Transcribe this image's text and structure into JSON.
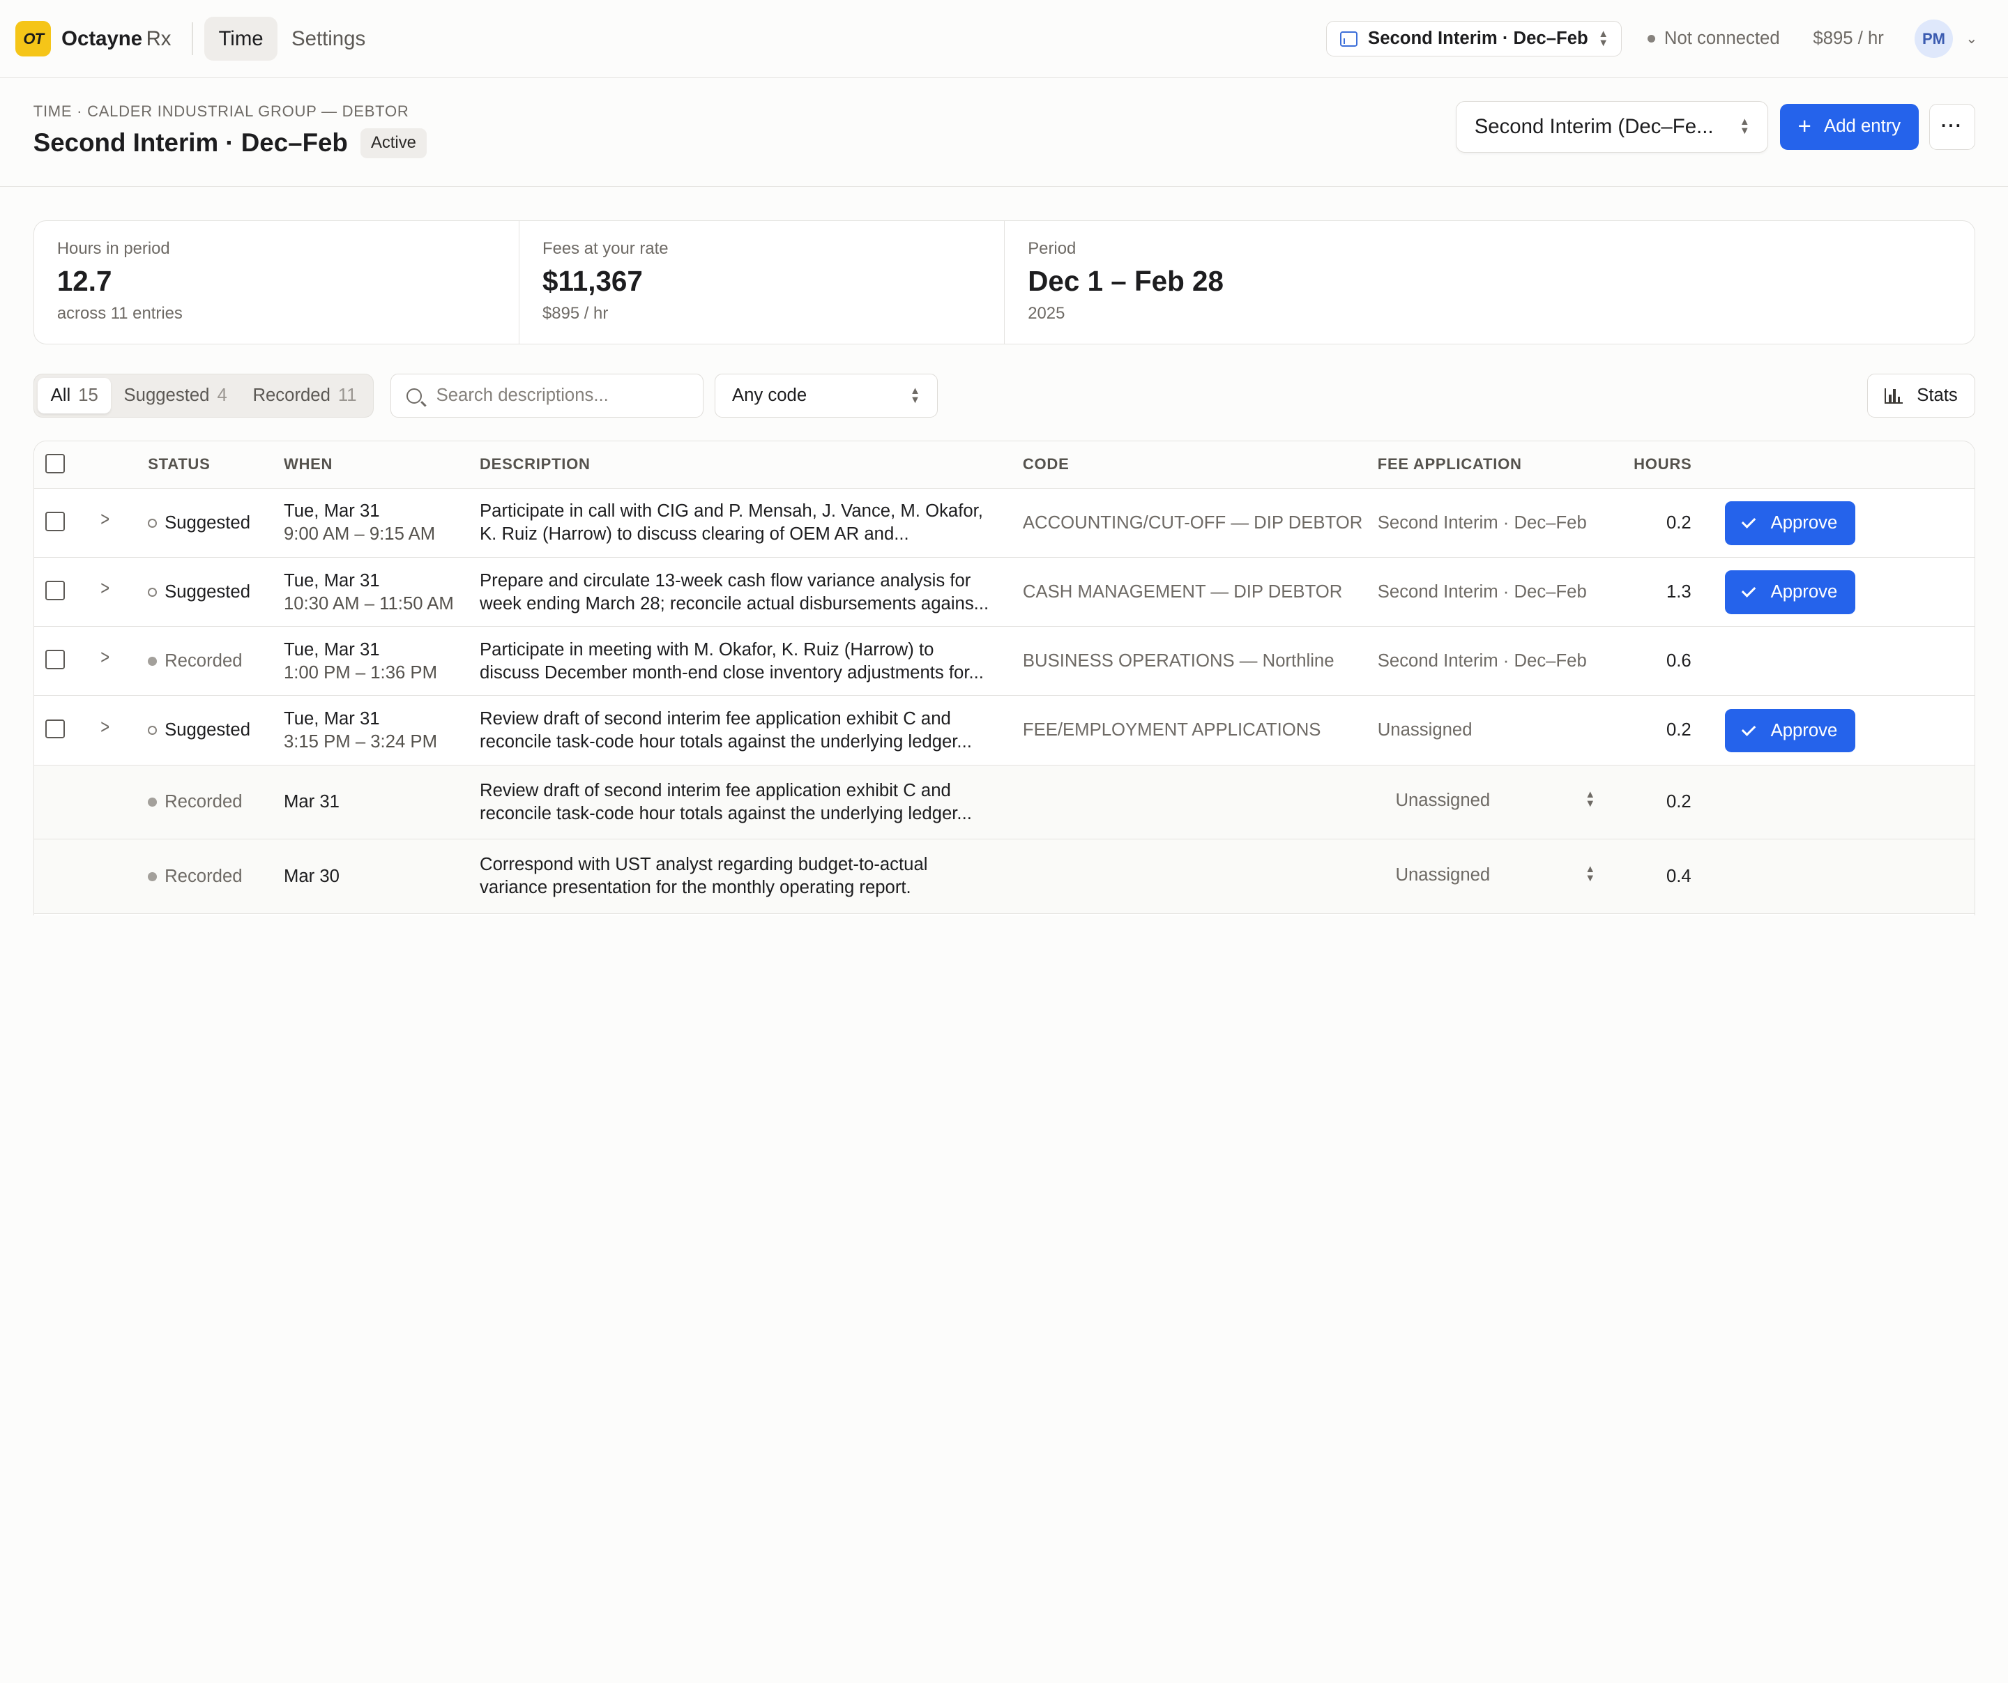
{
  "app": {
    "logo_text": "OT",
    "name": "Octayne",
    "name_suffix": "Rx",
    "nav": [
      {
        "label": "Time"
      },
      {
        "label": "Settings"
      }
    ],
    "period_switch": "Second Interim · Dec–Feb",
    "connection_status": "Not connected",
    "rate": "$895 / hr",
    "user_initials": "PM"
  },
  "header": {
    "breadcrumb": "TIME · CALDER INDUSTRIAL GROUP — DEBTOR",
    "title": "Second Interim · Dec–Feb",
    "badge": "Active",
    "period_select": "Second Interim (Dec–Fe...",
    "add_entry": "Add entry",
    "more": "···"
  },
  "stats": [
    {
      "label": "Hours in period",
      "value": "12.7",
      "sub": "across 11 entries"
    },
    {
      "label": "Fees at your rate",
      "value": "$11,367",
      "sub": "$895 / hr"
    },
    {
      "label": "Period",
      "value": "Dec 1 – Feb 28",
      "sub": "2025"
    }
  ],
  "filters": {
    "tabs": [
      {
        "label": "All",
        "count": "15"
      },
      {
        "label": "Suggested",
        "count": "4"
      },
      {
        "label": "Recorded",
        "count": "11"
      }
    ],
    "search_placeholder": "Search descriptions...",
    "code_select": "Any code",
    "stats_button": "Stats"
  },
  "table": {
    "columns": {
      "status": "STATUS",
      "when": "WHEN",
      "description": "DESCRIPTION",
      "code": "CODE",
      "fee_application": "FEE APPLICATION",
      "hours": "HOURS"
    },
    "approve_label": "Approve",
    "rows": [
      {
        "status": "Suggested",
        "date": "Tue, Mar 31",
        "time": "9:00 AM – 9:15 AM",
        "desc1": "Participate in call with CIG and P. Mensah, J. Vance, M. Okafor,",
        "desc2": "K. Ruiz (Harrow) to discuss clearing of OEM AR and...",
        "code": "ACCOUNTING/CUT-OFF — DIP DEBTOR",
        "fee_app": "Second Interim · Dec–Feb",
        "hours": "0.2"
      },
      {
        "status": "Suggested",
        "date": "Tue, Mar 31",
        "time": "10:30 AM – 11:50 AM",
        "desc1": "Prepare and circulate 13-week cash flow variance analysis for",
        "desc2": "week ending March 28; reconcile actual disbursements agains...",
        "code": "CASH MANAGEMENT — DIP DEBTOR",
        "fee_app": "Second Interim · Dec–Feb",
        "hours": "1.3"
      },
      {
        "status": "Recorded",
        "date": "Tue, Mar 31",
        "time": "1:00 PM – 1:36 PM",
        "desc1": "Participate in meeting with M. Okafor, K. Ruiz (Harrow) to",
        "desc2": "discuss December month-end close inventory adjustments for...",
        "code": "BUSINESS OPERATIONS — Northline",
        "fee_app": "Second Interim · Dec–Feb",
        "hours": "0.6"
      },
      {
        "status": "Suggested",
        "date": "Tue, Mar 31",
        "time": "3:15 PM – 3:24 PM",
        "desc1": "Review draft of second interim fee application exhibit C and",
        "desc2": "reconcile task-code hour totals against the underlying ledger...",
        "code": "FEE/EMPLOYMENT APPLICATIONS",
        "fee_app": "Unassigned",
        "hours": "0.2"
      },
      {
        "status": "Recorded",
        "date": "Mar 31",
        "desc1": "Review draft of second interim fee application exhibit C and",
        "desc2": "reconcile task-code hour totals against the underlying ledger...",
        "fee_app": "Unassigned",
        "hours": "0.2"
      },
      {
        "status": "Recorded",
        "date": "Mar 30",
        "desc1": "Correspond with UST analyst regarding budget-to-actual",
        "desc2": "variance presentation for the monthly operating report.",
        "fee_app": "Unassigned",
        "hours": "0.4"
      }
    ]
  },
  "colors": {
    "accent": "#2563eb",
    "logo": "#f5c518",
    "avatar_bg": "#dfe8fb"
  }
}
